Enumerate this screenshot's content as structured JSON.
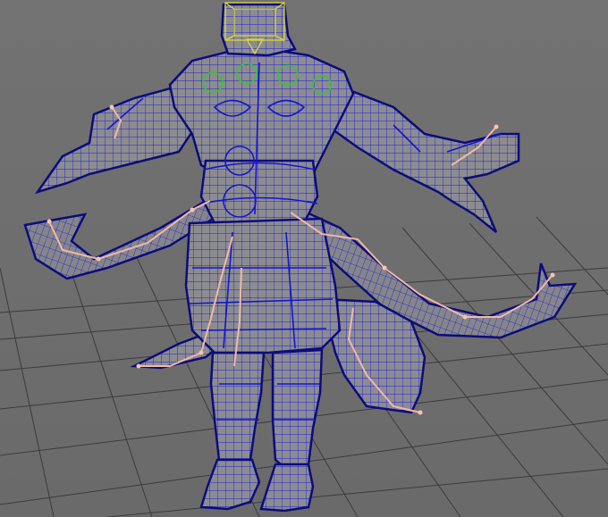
{
  "viewport": {
    "panel": "perspective-viewport",
    "mode": "wireframe-on-shaded",
    "model": "armored-monkey-warrior",
    "colors": {
      "background": "#6f6f6f",
      "grid": "#3a3a3a",
      "mesh_fill": "#8a8a8c",
      "wire": "#1a1ae6",
      "wire_dark": "#0c0c7a",
      "joint": "#f1b9a6",
      "selection": "#d8d83a",
      "control": "#32c832"
    },
    "icons": {
      "head_locator": "locator-icon",
      "shoulder_controls": "circle-control-icon"
    }
  }
}
